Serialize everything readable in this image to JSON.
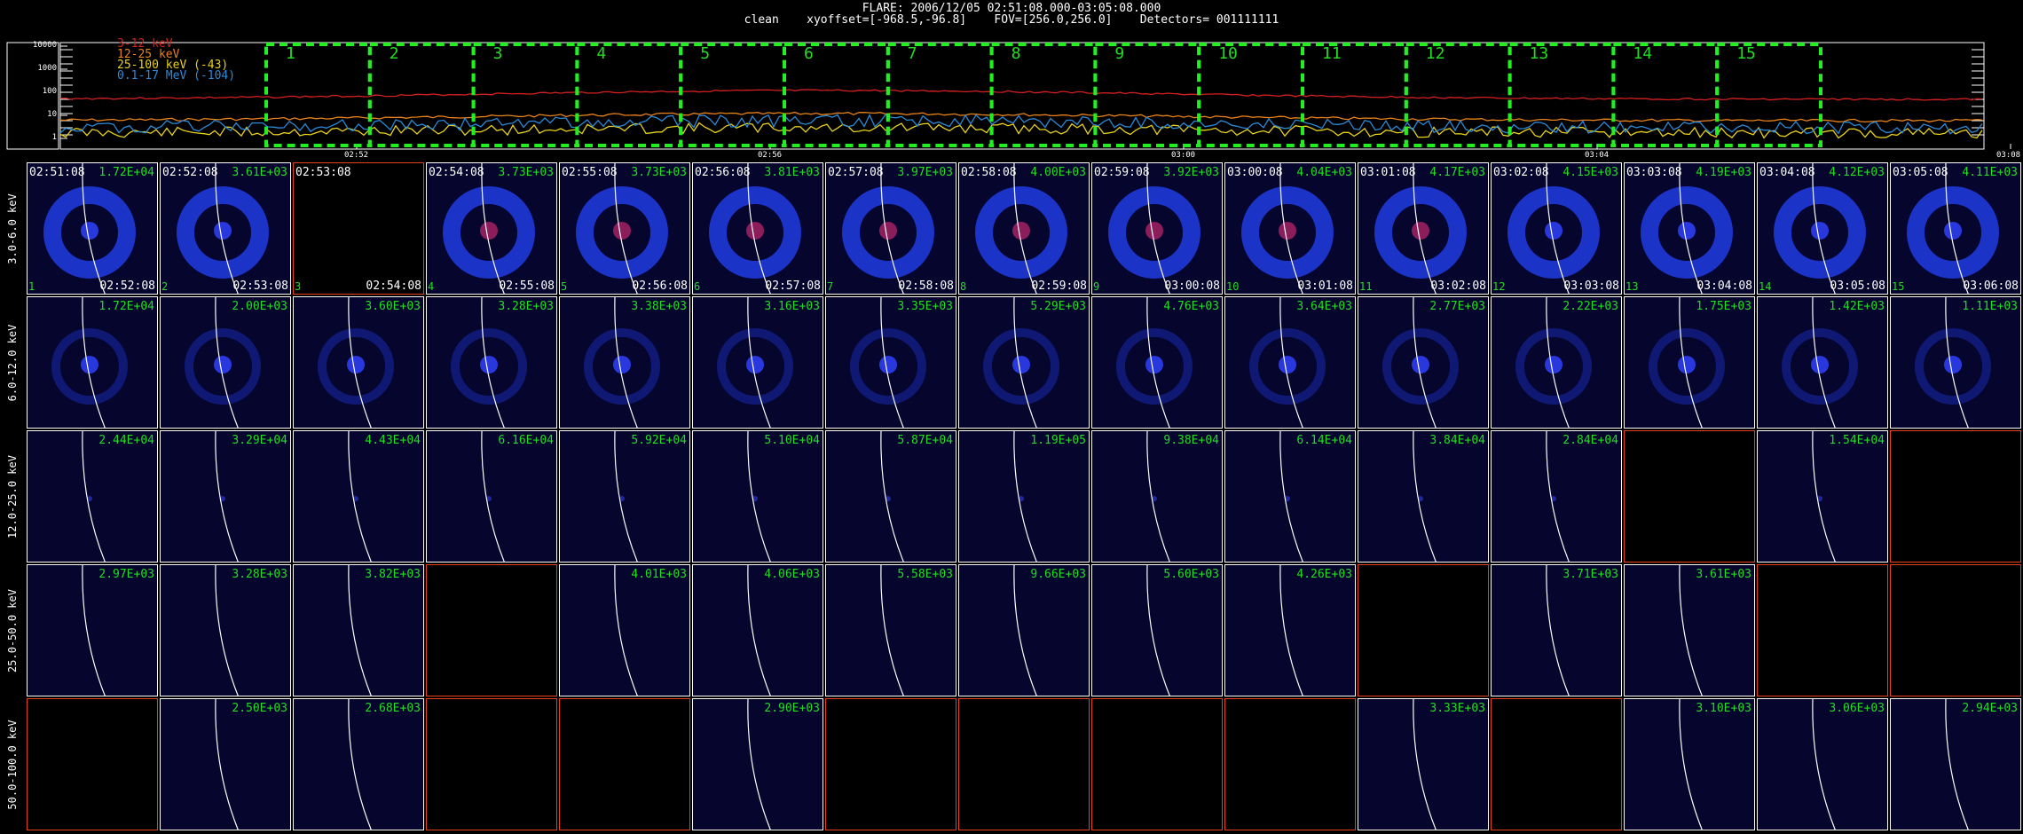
{
  "header": {
    "line1": "FLARE: 2006/12/05 02:51:08.000-03:05:08.000",
    "line2": "clean    xyoffset=[-968.5,-96.8]    FOV=[256.0,256.0]    Detectors= 001111111"
  },
  "lightcurve": {
    "y_ticks": [
      "10000",
      "1000",
      "100",
      "10",
      "1"
    ],
    "x_ticks": [
      "02:52",
      "02:56",
      "03:00",
      "03:04",
      "03:08"
    ],
    "legend": [
      {
        "label": "3-12 keV",
        "color": "#d42020"
      },
      {
        "label": "12-25 keV",
        "color": "#e8821a"
      },
      {
        "label": "25-100 keV (-43)",
        "color": "#e8d21a"
      },
      {
        "label": "0.1-17 MeV (-104)",
        "color": "#2a8ad8"
      }
    ],
    "intervals": [
      "1",
      "2",
      "3",
      "4",
      "5",
      "6",
      "7",
      "8",
      "9",
      "10",
      "11",
      "12",
      "13",
      "14",
      "15"
    ],
    "interval_color": "#22ee22"
  },
  "rows": [
    {
      "label": "3.0-6.0 keV"
    },
    {
      "label": "6.0-12.0 keV"
    },
    {
      "label": "12.0-25.0 keV"
    },
    {
      "label": "25.0-50.0 keV"
    },
    {
      "label": "50.0-100.0 keV"
    }
  ],
  "times_start": [
    "02:51:08",
    "02:52:08",
    "02:53:08",
    "02:54:08",
    "02:55:08",
    "02:56:08",
    "02:57:08",
    "02:58:08",
    "02:59:08",
    "03:00:08",
    "03:01:08",
    "03:02:08",
    "03:03:08",
    "03:04:08",
    "03:05:08"
  ],
  "times_end": [
    "02:52:08",
    "02:53:08",
    "02:54:08",
    "02:55:08",
    "02:56:08",
    "02:57:08",
    "02:58:08",
    "02:59:08",
    "03:00:08",
    "03:01:08",
    "03:02:08",
    "03:03:08",
    "03:04:08",
    "03:05:08",
    "03:06:08"
  ],
  "peaks": [
    [
      "1.72E+04",
      "3.61E+03",
      "",
      "3.73E+03",
      "3.73E+03",
      "3.81E+03",
      "3.97E+03",
      "4.00E+03",
      "3.92E+03",
      "4.04E+03",
      "4.17E+03",
      "4.15E+03",
      "4.19E+03",
      "4.12E+03",
      "4.11E+03"
    ],
    [
      "1.72E+04",
      "2.00E+03",
      "3.60E+03",
      "3.28E+03",
      "3.38E+03",
      "3.16E+03",
      "3.35E+03",
      "5.29E+03",
      "4.76E+03",
      "3.64E+03",
      "2.77E+03",
      "2.22E+03",
      "1.75E+03",
      "1.42E+03",
      "1.11E+03"
    ],
    [
      "2.44E+04",
      "3.29E+04",
      "4.43E+04",
      "6.16E+04",
      "5.92E+04",
      "5.10E+04",
      "5.87E+04",
      "1.19E+05",
      "9.38E+04",
      "6.14E+04",
      "3.84E+04",
      "2.84E+04",
      "",
      "1.54E+04",
      ""
    ],
    [
      "2.97E+03",
      "3.28E+03",
      "3.82E+03",
      "",
      "4.01E+03",
      "4.06E+03",
      "5.58E+03",
      "9.66E+03",
      "5.60E+03",
      "4.26E+03",
      "",
      "3.71E+03",
      "3.61E+03",
      "",
      ""
    ],
    [
      "",
      "2.50E+03",
      "2.68E+03",
      "",
      "",
      "2.90E+03",
      "",
      "",
      "",
      "",
      "3.33E+03",
      "",
      "3.10E+03",
      "3.06E+03",
      "2.94E+03"
    ]
  ],
  "colors": {
    "background": "#000000",
    "image_bg": "#05052e",
    "limb": "#ffffff",
    "text_green": "#22dd22",
    "empty_border": "#e8401a"
  }
}
